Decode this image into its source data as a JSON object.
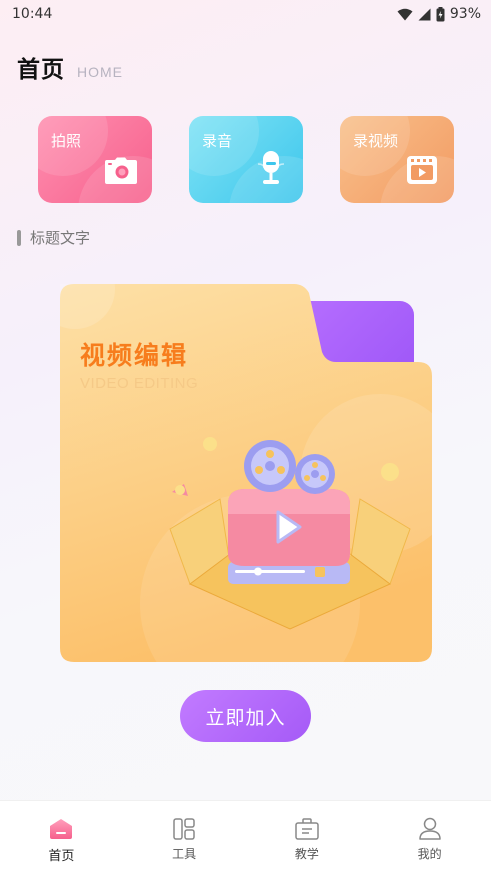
{
  "status_bar": {
    "time": "10:44",
    "battery": "93%"
  },
  "header": {
    "title": "首页",
    "subtitle": "HOME"
  },
  "features": [
    {
      "label": "拍照",
      "icon": "camera-icon"
    },
    {
      "label": "录音",
      "icon": "microphone-icon"
    },
    {
      "label": "录视频",
      "icon": "video-recorder-icon"
    }
  ],
  "section": {
    "title": "标题文字"
  },
  "banner": {
    "title": "视频编辑",
    "subtitle": "VIDEO EDITING",
    "illustration": "film-projector-icon"
  },
  "join_button": {
    "label": "立即加入"
  },
  "tab_bar": {
    "items": [
      {
        "label": "首页",
        "icon": "home-icon",
        "active": true
      },
      {
        "label": "工具",
        "icon": "tools-icon",
        "active": false
      },
      {
        "label": "教学",
        "icon": "briefcase-icon",
        "active": false
      },
      {
        "label": "我的",
        "icon": "profile-icon",
        "active": false
      }
    ]
  },
  "colors": {
    "accent_purple": "#a55af7",
    "photo_card": "#f6608c",
    "audio_card": "#3dc6ec",
    "video_card": "#f29b63",
    "banner_title": "#f77d1d",
    "folder": "#fdd389"
  }
}
